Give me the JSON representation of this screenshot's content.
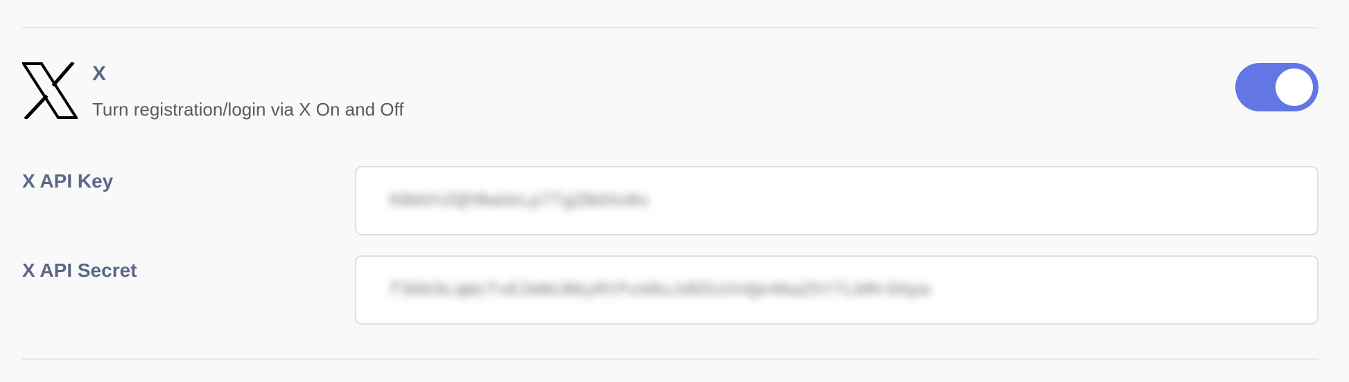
{
  "provider": {
    "logo_icon": "x-logo-icon",
    "title": "X",
    "description": "Turn registration/login via X On and Off",
    "enabled": true,
    "toggle_color": "#6276e4"
  },
  "fields": {
    "api_key": {
      "label": "X API Key",
      "value": "K8mVn2QhRwUeLp7TgZBd4sNx"
    },
    "api_secret": {
      "label": "X API Secret",
      "value": "f3Hk9LqWzTvE2mNcB6yRtPxA8uJdG5sVnQe4KwZhY7LbMr0Xpa"
    }
  }
}
